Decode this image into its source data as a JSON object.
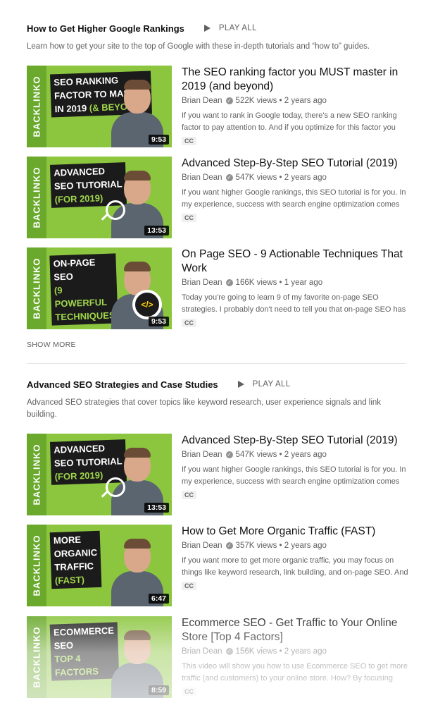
{
  "sections": [
    {
      "title": "How to Get Higher Google Rankings",
      "play_all": "PLAY ALL",
      "description": "Learn how to get your site to the top of Google with these in-depth tutorials and “how to” guides.",
      "videos": [
        {
          "title": "The SEO ranking factor you MUST master in 2019 (and beyond)",
          "channel": "Brian Dean",
          "stats": "522K views • 2 years ago",
          "description": "If you want to rank in Google today, there's a new SEO ranking factor to pay attention to. And if you optimize for this factor you",
          "badge": "CC",
          "duration": "9:53",
          "thumb_brand": "BACKLINKO",
          "thumb_lines": [
            "SEO RANKING",
            "FACTOR TO MASTER",
            "IN 2019"
          ],
          "thumb_highlight": "(& BEYOND)"
        },
        {
          "title": "Advanced Step-By-Step SEO Tutorial (2019)",
          "channel": "Brian Dean",
          "stats": "547K views • 2 years ago",
          "description": "If you want higher Google rankings, this SEO tutorial is for you. In my experience, success with search engine optimization comes",
          "badge": "CC",
          "duration": "13:53",
          "thumb_brand": "BACKLINKO",
          "thumb_lines": [
            "ADVANCED",
            "SEO TUTORIAL"
          ],
          "thumb_highlight": "(FOR 2019)"
        },
        {
          "title": "On Page SEO - 9 Actionable Techniques That Work",
          "channel": "Brian Dean",
          "stats": "166K views • 1 year ago",
          "description": "Today you're going to learn 9 of my favorite on-page SEO strategies. I probably don't need to tell you that on-page SEO has",
          "badge": "CC",
          "duration": "9:53",
          "thumb_brand": "BACKLINKO",
          "thumb_lines": [
            "ON-PAGE SEO"
          ],
          "thumb_highlight": "(9 POWERFUL TECHNIQUES)",
          "thumb_icon": "</>"
        }
      ],
      "show_more": "SHOW MORE"
    },
    {
      "title": "Advanced SEO Strategies and Case Studies",
      "play_all": "PLAY ALL",
      "description": "Advanced SEO strategies that cover topics like keyword research, user experience signals and link building.",
      "videos": [
        {
          "title": "Advanced Step-By-Step SEO Tutorial (2019)",
          "channel": "Brian Dean",
          "stats": "547K views • 2 years ago",
          "description": "If you want higher Google rankings, this SEO tutorial is for you. In my experience, success with search engine optimization comes",
          "badge": "CC",
          "duration": "13:53",
          "thumb_brand": "BACKLINKO",
          "thumb_lines": [
            "ADVANCED",
            "SEO TUTORIAL"
          ],
          "thumb_highlight": "(FOR 2019)"
        },
        {
          "title": "How to Get More Organic Traffic (FAST)",
          "channel": "Brian Dean",
          "stats": "357K views • 2 years ago",
          "description": "If you want more to get more organic traffic, you may focus on things like keyword research, link building, and on-page SEO. And",
          "badge": "CC",
          "duration": "6:47",
          "thumb_brand": "BACKLINKO",
          "thumb_lines": [
            "MORE",
            "ORGANIC",
            "TRAFFIC"
          ],
          "thumb_highlight": "(FAST)"
        },
        {
          "title": "Ecommerce SEO - Get Traffic to Your Online Store [Top 4 Factors]",
          "channel": "Brian Dean",
          "stats": "156K views • 2 years ago",
          "description": "This video will show you how to use Ecommerce SEO to get more traffic (and customers) to your online store. How? By focusing",
          "badge": "CC",
          "duration": "8:59",
          "thumb_brand": "BACKLINKO",
          "thumb_lines": [
            "ECOMMERCE",
            "SEO"
          ],
          "thumb_highlight": "TOP 4 FACTORS"
        }
      ]
    }
  ]
}
